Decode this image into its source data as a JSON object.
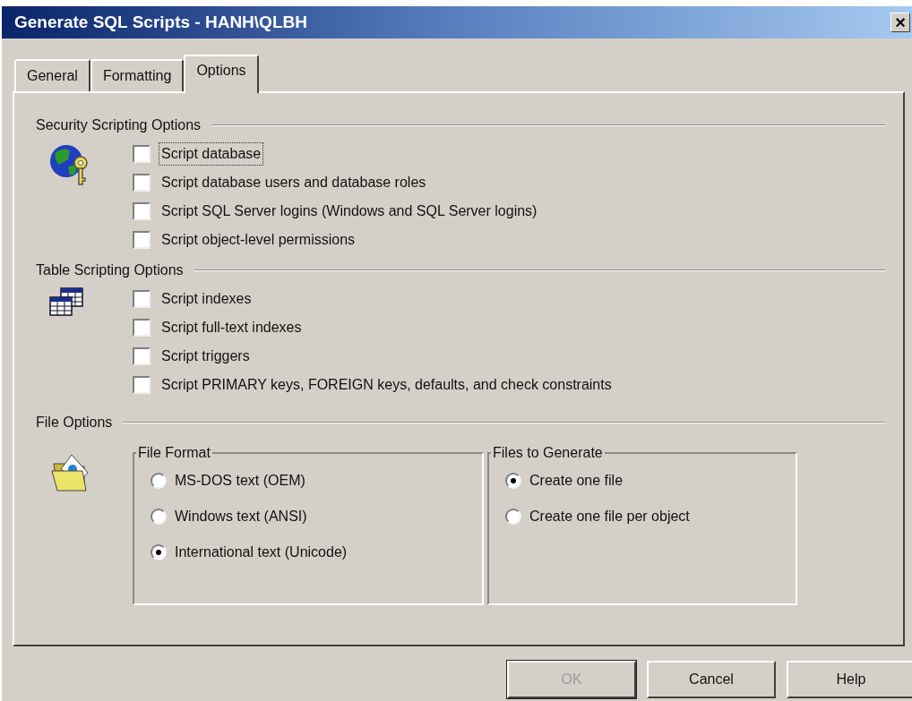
{
  "window": {
    "title": "Generate SQL Scripts - HANH\\QLBH",
    "close": "×"
  },
  "tabs": [
    {
      "label": "General",
      "selected": false
    },
    {
      "label": "Formatting",
      "selected": false
    },
    {
      "label": "Options",
      "selected": true
    }
  ],
  "sections": [
    {
      "title": "Security Scripting Options",
      "options": [
        {
          "label": "Script database",
          "checked": false,
          "focused": true
        },
        {
          "label": "Script database users and database roles",
          "checked": false,
          "focused": false
        },
        {
          "label": "Script SQL Server logins (Windows and SQL Server logins)",
          "checked": false,
          "focused": false
        },
        {
          "label": "Script object-level permissions",
          "checked": false,
          "focused": false
        }
      ]
    },
    {
      "title": "Table Scripting Options",
      "options": [
        {
          "label": "Script indexes",
          "checked": false,
          "focused": false
        },
        {
          "label": "Script full-text indexes",
          "checked": false,
          "focused": false
        },
        {
          "label": "Script triggers",
          "checked": false,
          "focused": false
        },
        {
          "label": "Script PRIMARY keys, FOREIGN keys, defaults, and check constraints",
          "checked": false,
          "focused": false
        }
      ]
    }
  ],
  "file_options": {
    "title": "File Options",
    "groups": [
      {
        "title": "File Format",
        "options": [
          {
            "label": "MS-DOS text (OEM)",
            "selected": false
          },
          {
            "label": "Windows text (ANSI)",
            "selected": false
          },
          {
            "label": "International text (Unicode)",
            "selected": true
          }
        ]
      },
      {
        "title": "Files to Generate",
        "options": [
          {
            "label": "Create one file",
            "selected": true
          },
          {
            "label": "Create one file per object",
            "selected": false
          }
        ]
      }
    ]
  },
  "buttons": [
    {
      "label": "OK",
      "disabled": true
    },
    {
      "label": "Cancel",
      "disabled": false
    },
    {
      "label": "Help",
      "disabled": false
    }
  ]
}
